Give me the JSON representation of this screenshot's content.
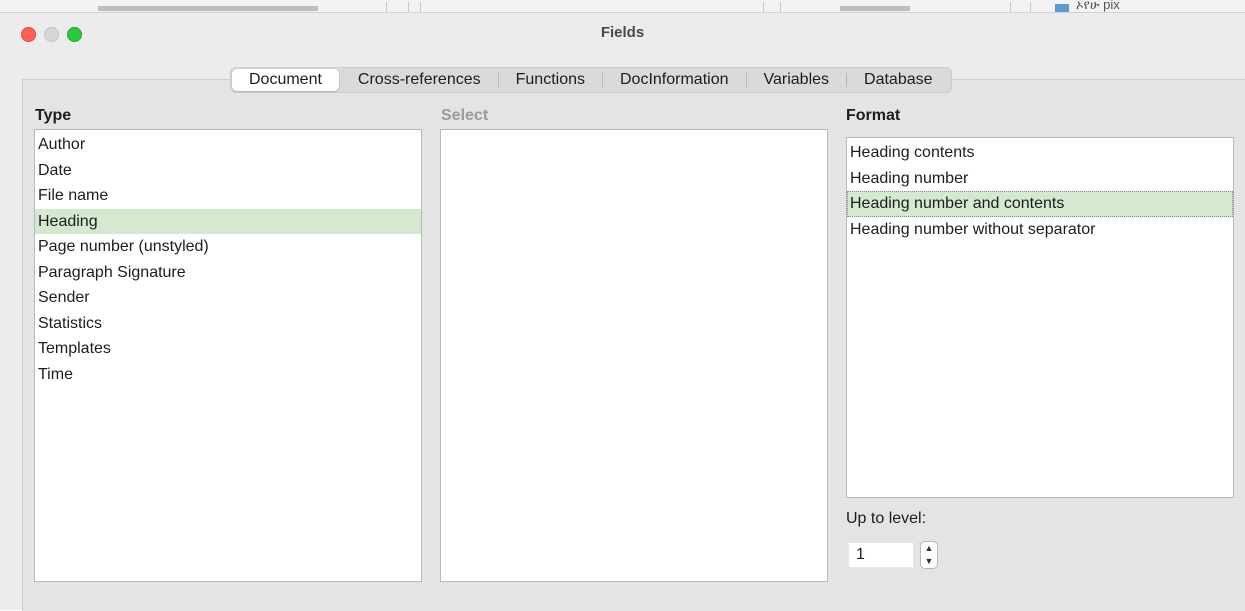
{
  "background": {
    "partial_label": "ኦየሁ pix"
  },
  "window": {
    "title": "Fields"
  },
  "tabs": [
    {
      "label": "Document",
      "selected": true
    },
    {
      "label": "Cross-references",
      "selected": false
    },
    {
      "label": "Functions",
      "selected": false
    },
    {
      "label": "DocInformation",
      "selected": false
    },
    {
      "label": "Variables",
      "selected": false
    },
    {
      "label": "Database",
      "selected": false
    }
  ],
  "type_panel": {
    "label": "Type",
    "items": [
      "Author",
      "Date",
      "File name",
      "Heading",
      "Page number (unstyled)",
      "Paragraph Signature",
      "Sender",
      "Statistics",
      "Templates",
      "Time"
    ],
    "selected": "Heading"
  },
  "select_panel": {
    "label": "Select",
    "items": []
  },
  "format_panel": {
    "label": "Format",
    "items": [
      "Heading contents",
      "Heading number",
      "Heading number and contents",
      "Heading number without separator"
    ],
    "selected": "Heading number and contents"
  },
  "level": {
    "label": "Up to level:",
    "value": "1"
  },
  "colors": {
    "selection": "#d5e8d0",
    "close": "#fe5f57",
    "maximize": "#28c840"
  }
}
